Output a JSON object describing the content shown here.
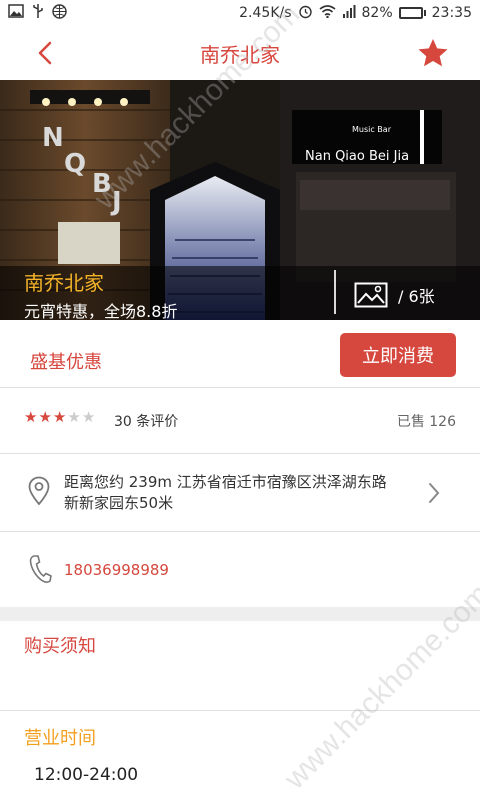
{
  "status_bar": {
    "network_speed": "2.45K/s",
    "battery_percent": "82%",
    "battery_level": 0.82,
    "time": "23:35"
  },
  "nav": {
    "title": "南乔北家"
  },
  "hero": {
    "name": "南乔北家",
    "promo": "元宵特惠，全场8.8折",
    "photo_count": "/ 6张",
    "sign_text": "Nan Qiao Bei Jia",
    "sign_small": "Music Bar",
    "letters": [
      "N",
      "Q",
      "B",
      "J"
    ]
  },
  "deal": {
    "title": "盛基优惠",
    "buy_label": "立即消费"
  },
  "rating": {
    "stars_filled": 3,
    "stars_total": 5,
    "reviews": "30 条评价",
    "sold": "已售 126"
  },
  "address": {
    "text": "距离您约 239m 江苏省宿迁市宿豫区洪泽湖东路新新家园东50米"
  },
  "phone": {
    "number": "18036998989"
  },
  "notice": {
    "title": "购买须知"
  },
  "hours": {
    "title": "营业时间",
    "value": "12:00-24:00"
  },
  "watermark": "www.hackhome.com",
  "colors": {
    "accent": "#d6473e",
    "orange": "#f3a020",
    "gold": "#f3b228"
  }
}
